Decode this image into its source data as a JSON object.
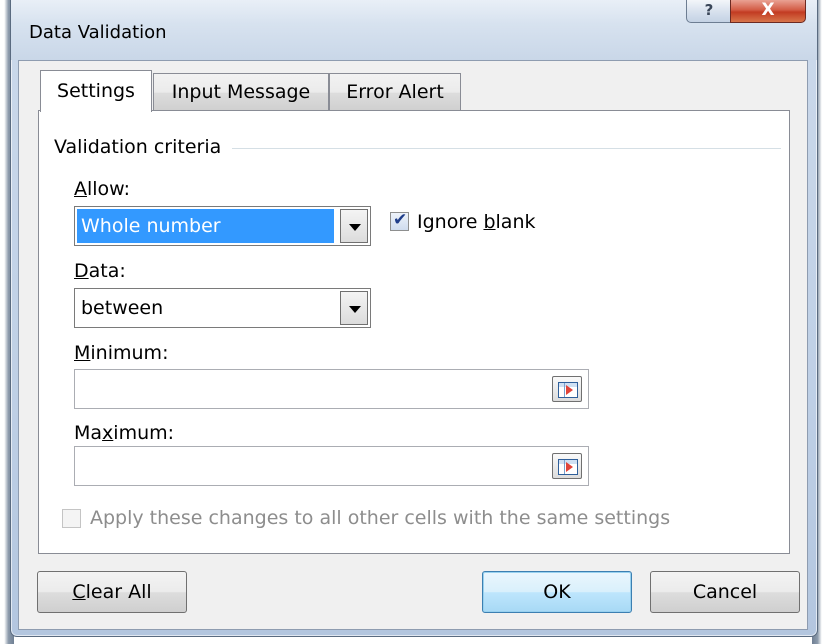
{
  "window": {
    "title": "Data Validation",
    "help_label": "?",
    "close_label": "X"
  },
  "tabs": [
    {
      "label": "Settings",
      "active": true
    },
    {
      "label": "Input Message",
      "active": false
    },
    {
      "label": "Error Alert",
      "active": false
    }
  ],
  "criteria": {
    "group_label": "Validation criteria",
    "allow_label_key": "A",
    "allow_label_rest": "llow:",
    "allow_value": "Whole number",
    "ignore_blank_pre": "Ignore ",
    "ignore_blank_key": "b",
    "ignore_blank_post": "lank",
    "ignore_blank_checked": true,
    "data_label_key": "D",
    "data_label_rest": "ata:",
    "data_value": "between",
    "minimum_label_key": "M",
    "minimum_label_rest": "inimum:",
    "minimum_value": "",
    "maximum_label_pre": "Ma",
    "maximum_label_key": "x",
    "maximum_label_post": "imum:",
    "maximum_value": "",
    "apply_label": "Apply these changes to all other cells with the same settings",
    "apply_checked": false
  },
  "buttons": {
    "clear_key": "C",
    "clear_rest": "lear All",
    "ok": "OK",
    "cancel": "Cancel"
  }
}
